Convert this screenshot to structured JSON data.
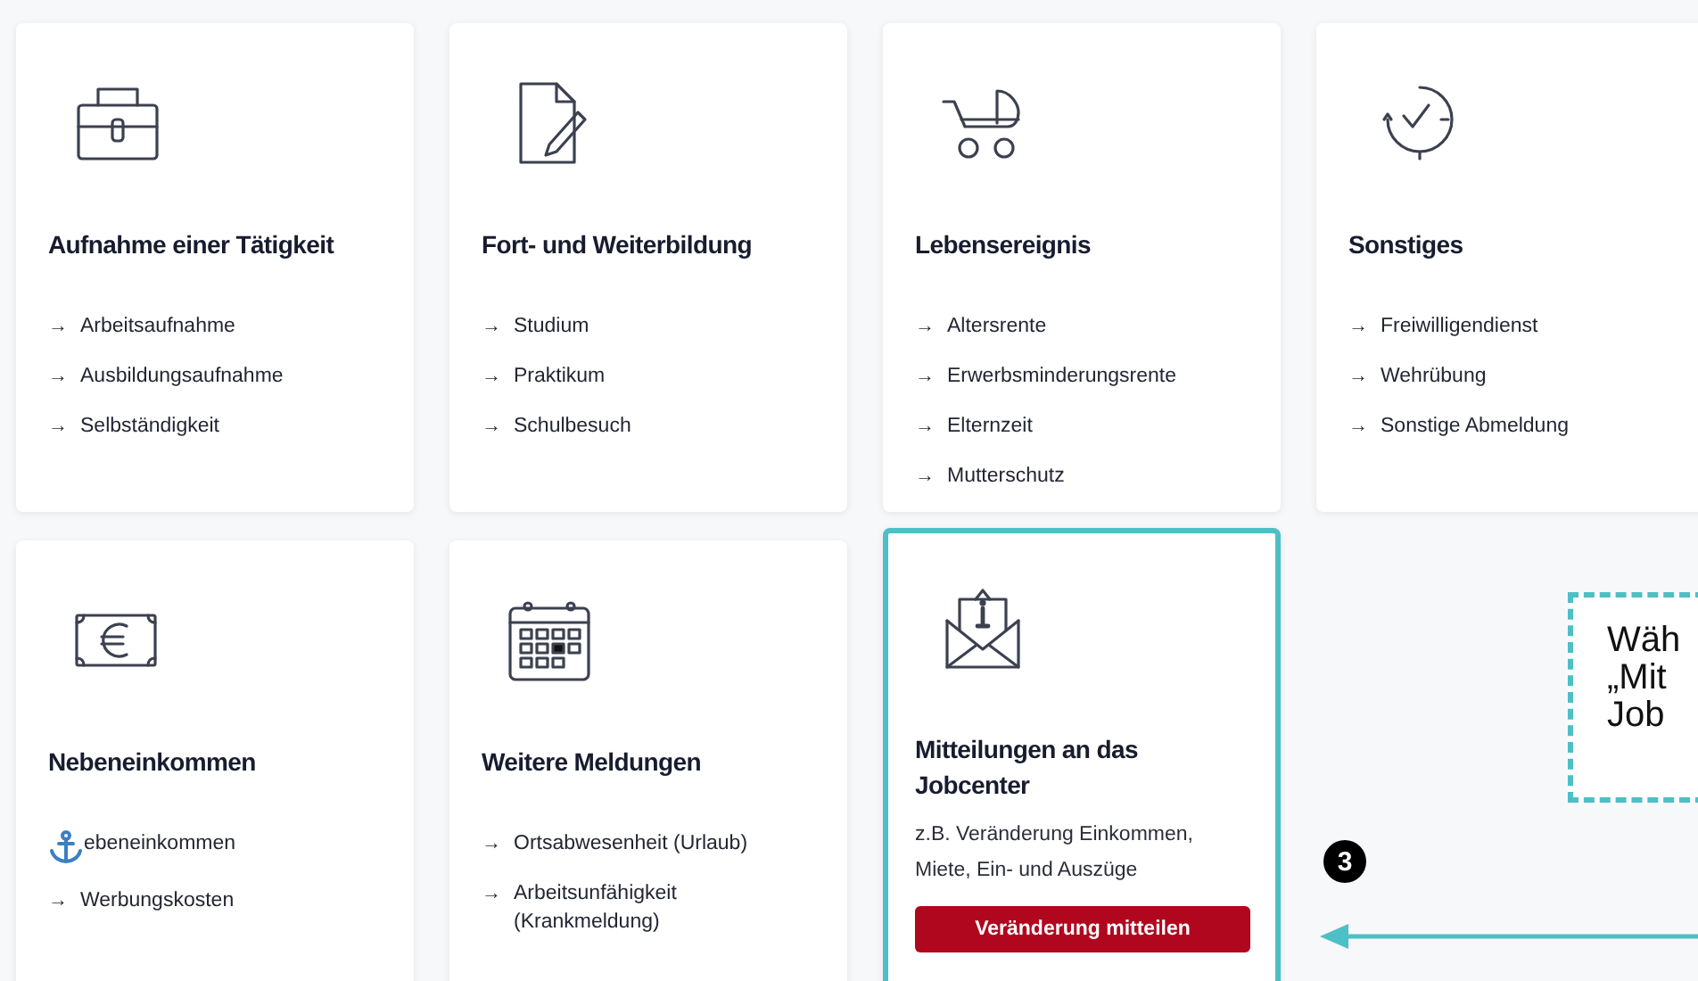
{
  "rows": [
    [
      {
        "kind": "links",
        "title": "Aufnahme einer Tätigkeit",
        "highlighted": false,
        "links": [
          {
            "kind": "arrow",
            "marker": "→",
            "text": "Arbeitsaufnahme"
          },
          {
            "kind": "arrow",
            "marker": "→",
            "text": "Ausbildungsaufnahme"
          },
          {
            "kind": "arrow",
            "marker": "→",
            "text": "Selbständigkeit"
          }
        ]
      },
      {
        "kind": "links",
        "title": "Fort- und Weiterbildung",
        "highlighted": false,
        "links": [
          {
            "kind": "arrow",
            "marker": "→",
            "text": "Studium"
          },
          {
            "kind": "arrow",
            "marker": "→",
            "text": "Praktikum"
          },
          {
            "kind": "arrow",
            "marker": "→",
            "text": "Schulbesuch"
          }
        ]
      },
      {
        "kind": "links",
        "title": "Lebensereignis",
        "highlighted": false,
        "links": [
          {
            "kind": "arrow",
            "marker": "→",
            "text": "Altersrente"
          },
          {
            "kind": "arrow",
            "marker": "→",
            "text": "Erwerbsminderungsrente"
          },
          {
            "kind": "arrow",
            "marker": "→",
            "text": "Elternzeit"
          },
          {
            "kind": "arrow",
            "marker": "→",
            "text": "Mutterschutz"
          }
        ]
      },
      {
        "kind": "links",
        "title": "Sonstiges",
        "highlighted": false,
        "links": [
          {
            "kind": "arrow",
            "marker": "→",
            "text": "Freiwilligendienst"
          },
          {
            "kind": "arrow",
            "marker": "→",
            "text": "Wehrübung"
          },
          {
            "kind": "arrow",
            "marker": "→",
            "text": "Sonstige Abmeldung"
          }
        ]
      }
    ],
    [
      {
        "kind": "links",
        "title": "Nebeneinkommen",
        "highlighted": false,
        "links": [
          {
            "kind": "anchor",
            "text": "ebeneinkommen"
          },
          {
            "kind": "arrow",
            "marker": "→",
            "text": "Werbungskosten"
          }
        ]
      },
      {
        "kind": "links",
        "title": "Weitere Meldungen",
        "highlighted": false,
        "links": [
          {
            "kind": "arrow",
            "marker": "→",
            "text": "Ortsabwesenheit (Urlaub)"
          },
          {
            "kind": "arrow",
            "marker": "→",
            "text": "Arbeitsunfähigkeit (Krankmeldung)"
          }
        ]
      },
      {
        "kind": "action",
        "title": "Mitteilungen an das Jobcenter",
        "highlighted": true,
        "description": "z.B. Veränderung Einkommen, Miete, Ein- und Auszüge",
        "button": "Veränderung mitteilen"
      }
    ]
  ],
  "callout": {
    "lines": [
      "Wäh",
      "„Mit",
      "Job"
    ],
    "badge": "3"
  }
}
